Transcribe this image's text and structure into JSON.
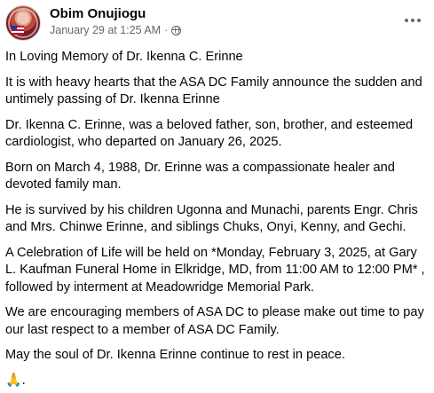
{
  "post": {
    "author": "Obim Onujiogu",
    "timestamp": "January 29 at 1:25 AM",
    "separator": "·",
    "privacy_icon": "globe-icon",
    "more_icon": "more-horizontal-icon",
    "paragraphs": [
      "In Loving Memory of Dr. Ikenna C. Erinne",
      "It is with heavy hearts that the ASA DC Family announce the sudden and untimely passing of Dr. Ikenna Erinne",
      "Dr. Ikenna C. Erinne, was a beloved father, son, brother, and esteemed cardiologist, who departed on January 26, 2025.",
      "Born on March 4, 1988, Dr. Erinne was a compassionate healer and devoted family man.",
      "He is survived by his children Ugonna and Munachi, parents Engr. Chris and Mrs. Chinwe Erinne, and siblings Chuks, Onyi, Kenny, and Gechi.",
      "A Celebration of Life will be held on *Monday, February 3, 2025, at Gary L. Kaufman Funeral Home in Elkridge, MD, from 11:00 AM to 12:00 PM* , followed by interment at Meadowridge Memorial Park.",
      "We are encouraging members of ASA DC to please make out time to pay our last respect to a member of ASA DC Family.",
      "May the soul of Dr. Ikenna Erinne continue to rest in peace."
    ],
    "closing": "🙏."
  }
}
